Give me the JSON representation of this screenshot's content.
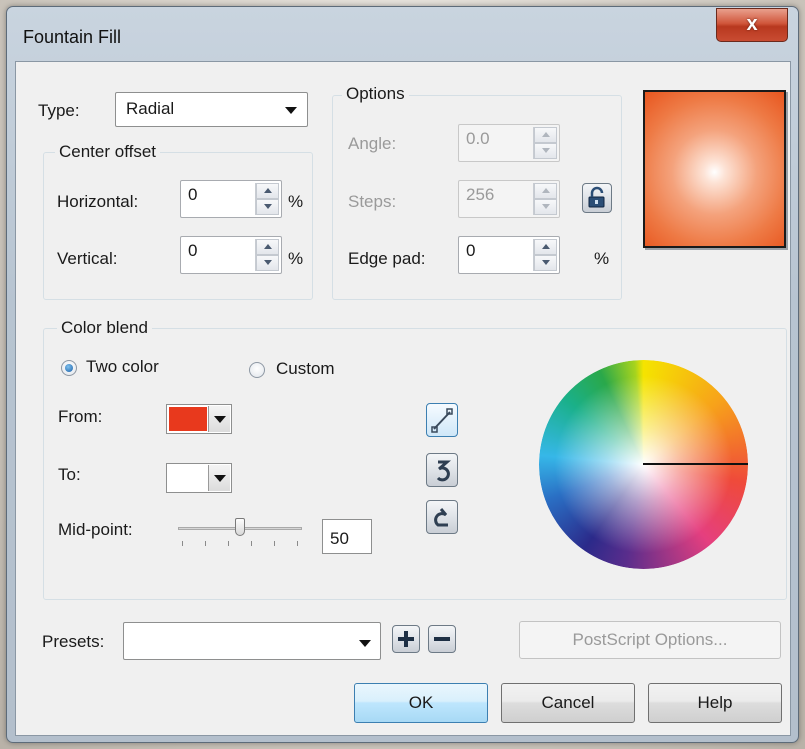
{
  "window": {
    "title": "Fountain Fill",
    "close_glyph": "x"
  },
  "type": {
    "label": "Type:",
    "value": "Radial"
  },
  "center_offset": {
    "legend": "Center offset",
    "horizontal_label": "Horizontal:",
    "horizontal_value": "0",
    "vertical_label": "Vertical:",
    "vertical_value": "0",
    "unit": "%"
  },
  "options": {
    "legend": "Options",
    "angle_label": "Angle:",
    "angle_value": "0.0",
    "steps_label": "Steps:",
    "steps_value": "256",
    "edge_pad_label": "Edge pad:",
    "edge_pad_value": "0",
    "unit": "%"
  },
  "color_blend": {
    "legend": "Color blend",
    "two_color_label": "Two color",
    "two_color_selected": true,
    "custom_label": "Custom",
    "from_label": "From:",
    "from_color": "#e8391d",
    "to_label": "To:",
    "to_color": "#ffffff",
    "midpoint_label": "Mid-point:",
    "midpoint_value": "50"
  },
  "presets": {
    "label": "Presets:",
    "value": ""
  },
  "buttons": {
    "postscript": "PostScript Options...",
    "ok": "OK",
    "cancel": "Cancel",
    "help": "Help"
  },
  "icons": {
    "close": "close-icon",
    "lock": "lock-icon",
    "direct": "direct-path-icon",
    "ccw": "counterclockwise-path-icon",
    "cw": "clockwise-path-icon",
    "add": "add-preset-icon",
    "remove": "remove-preset-icon"
  }
}
